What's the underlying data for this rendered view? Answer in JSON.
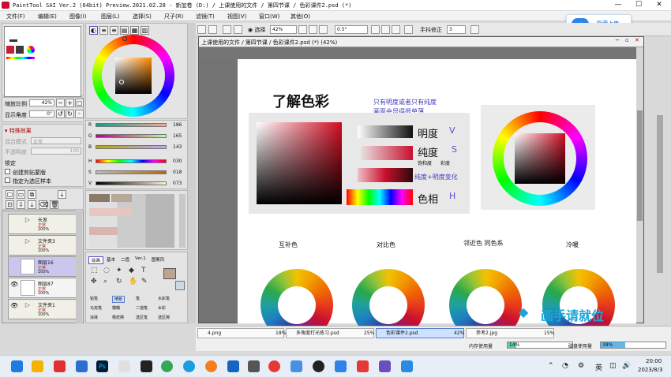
{
  "window": {
    "title": "PaintTool SAI Ver.2 (64bit) Preview.2021.02.28 - 新加卷 (D:) / 上课使用的文件 / 第四节课 / 色彩课件2.psd (*)"
  },
  "menu": [
    "文件(F)",
    "编辑(E)",
    "图像(I)",
    "图层(L)",
    "选择(S)",
    "尺子(R)",
    "滤镜(T)",
    "视图(V)",
    "窗口(W)",
    "其他(O)"
  ],
  "cloud_popup": {
    "label": "隐藏上传"
  },
  "navigator": {
    "zoom_label": "缩放比例",
    "zoom_value": "42%",
    "angle_label": "显示角度",
    "angle_value": "0°"
  },
  "special_effects": {
    "header": "特殊效果",
    "blend_label": "混合模式",
    "blend_value": "正常",
    "opacity_label": "不透明度",
    "opacity_value": "100",
    "protect_label": "锁定",
    "clip_label": "创建剪贴蒙版",
    "selection_label": "指定为选区样本"
  },
  "layers": [
    {
      "name": "长发",
      "mode": "正常",
      "opacity": "100%",
      "selected": false
    },
    {
      "name": "文件夹3",
      "mode": "正常",
      "opacity": "100%",
      "selected": false
    },
    {
      "name": "图层16",
      "mode": "正常",
      "opacity": "100%",
      "selected": true
    },
    {
      "name": "图层87",
      "mode": "正常",
      "opacity": "100%",
      "selected": false
    },
    {
      "name": "文件夹1",
      "mode": "正常",
      "opacity": "100%",
      "selected": false
    }
  ],
  "color_sliders": [
    {
      "label": "R",
      "value": "186"
    },
    {
      "label": "G",
      "value": "165"
    },
    {
      "label": "B",
      "value": "143"
    },
    {
      "label": "H",
      "value": "030"
    },
    {
      "label": "S",
      "value": "018"
    },
    {
      "label": "V",
      "value": "073"
    }
  ],
  "tool_tabs": [
    "绘画",
    "基本",
    "二值",
    "Ver.1",
    "图案风"
  ],
  "tools": [
    "铅笔",
    "喷枪",
    "笔",
    "水彩笔",
    "马克笔",
    "模糊",
    "二值笔",
    "水彩",
    "涂抹",
    "橡皮擦",
    "选区笔",
    "选区擦"
  ],
  "toolbar": {
    "select_label": "选择",
    "zoom_value": "42%",
    "angle_value": "0.5°",
    "stabilizer_label": "手抖修正",
    "stabilizer_value": "3"
  },
  "document": {
    "tab_title": "上课使用的文件 / 第四节课 / 色彩课件2.psd (*) (42%)",
    "heading": "了解色彩",
    "note_line1": "只有明度或者只有纯度",
    "note_line2": "画面会显得很单薄",
    "lightness_label": "明度",
    "lightness_mark": "V",
    "purity_label": "纯度",
    "purity_mark": "S",
    "purity_sub1": "饱和度",
    "purity_sub2": "彩度",
    "mix_label": "纯度+明度变化",
    "hue_label": "色相",
    "hue_mark": "H",
    "wheel_titles": [
      "互补色",
      "对比色",
      "邻近色 同色系",
      "冷暖"
    ],
    "watermark": "画手请就位"
  },
  "doc_tabs": [
    {
      "name": "4.png",
      "zoom": "18%"
    },
    {
      "name": "多角度打光练习.psd",
      "zoom": "25%"
    },
    {
      "name": "色彩课件2.psd",
      "zoom": "42%"
    },
    {
      "name": "参考2.jpg",
      "zoom": "15%"
    }
  ],
  "memory": {
    "mem_label": "内存使用量",
    "mem_value": "14%",
    "mem_pct": 0.14,
    "disk_label": "磁盘使用量",
    "disk_value": "38%",
    "disk_pct": 0.38
  },
  "taskbar": {
    "lang": "英",
    "time": "20:00",
    "date": "2023/8/3"
  },
  "colors": {
    "accent": "#5b4fcf",
    "main_swatch": "#bba58f"
  }
}
